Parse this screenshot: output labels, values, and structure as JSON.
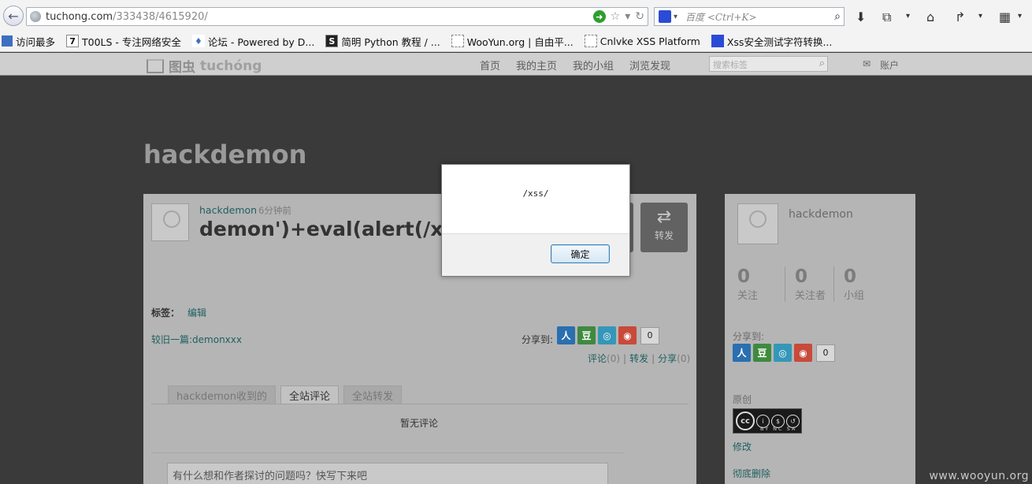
{
  "browser": {
    "url_host": "tuchong.com",
    "url_path": "/333438/4615920/",
    "search_placeholder": "百度 <Ctrl+K>",
    "bookmarks": [
      {
        "icon": "bookmark-folder-icon",
        "label": "访问最多"
      },
      {
        "icon": "tools-icon",
        "label": "T00LS - 专注网络安全"
      },
      {
        "icon": "shield-icon",
        "label": "论坛 - Powered by D..."
      },
      {
        "icon": "s-logo-icon",
        "label": "简明 Python 教程 / ..."
      },
      {
        "icon": "page-icon",
        "label": "WooYun.org | 自由平..."
      },
      {
        "icon": "page-icon",
        "label": "Cnlvke XSS Platform"
      },
      {
        "icon": "paw-icon",
        "label": "Xss安全测试字符转换..."
      }
    ]
  },
  "site": {
    "logo_cn": "图虫",
    "logo_en": "tuchóng",
    "nav": [
      "首页",
      "我的主页",
      "我的小组",
      "浏览发现"
    ],
    "search_placeholder": "搜索标签",
    "account": "账户"
  },
  "profile": {
    "username": "hackdemon"
  },
  "post": {
    "author": "hackdemon",
    "time": "6分钟前",
    "title": "demon')+eval(alert(/xss/",
    "repost_label": "转发",
    "tags_label": "标签：",
    "edit_label": "编辑",
    "older_link": "较旧一篇:demonxxx",
    "share_label": "分享到:",
    "share_count": "0",
    "actions": {
      "comment": "评论",
      "comment_n": "(0)",
      "repost": "转发",
      "share": "分享",
      "share_n": "(0)"
    },
    "tabs": [
      "hackdemon收到的",
      "全站评论",
      "全站转发"
    ],
    "active_tab": 1,
    "no_comment": "暂无评论",
    "comment_placeholder": "有什么想和作者探讨的问题吗？快写下来吧"
  },
  "sidebar": {
    "name": "hackdemon",
    "stats": [
      {
        "num": "0",
        "label": "关注"
      },
      {
        "num": "0",
        "label": "关注者"
      },
      {
        "num": "0",
        "label": "小组"
      }
    ],
    "share_label": "分享到:",
    "share_count": "0",
    "license_label": "原创",
    "license_caption": "BY NC SA",
    "links": [
      "修改",
      "彻底删除"
    ]
  },
  "dialog": {
    "message": "/xss/",
    "ok_label": "确定"
  },
  "watermark": "www.wooyun.org"
}
